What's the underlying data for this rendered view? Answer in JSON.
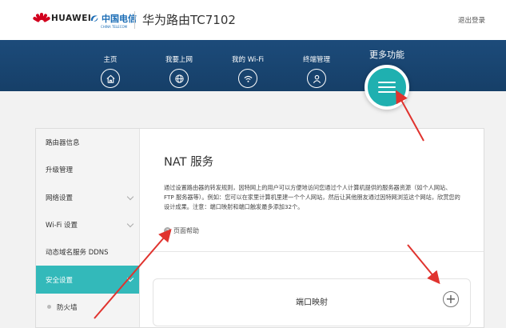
{
  "header": {
    "brand": "HUAWEI",
    "telecom_name": "中国电信",
    "telecom_sub": "CHINA TELECOM",
    "product_title": "华为路由TC7102",
    "logout_label": "退出登录"
  },
  "nav": {
    "items": [
      {
        "label": "主页",
        "icon": "home-icon"
      },
      {
        "label": "我要上网",
        "icon": "globe-icon"
      },
      {
        "label": "我的 Wi-Fi",
        "icon": "wifi-icon"
      },
      {
        "label": "终端管理",
        "icon": "user-icon"
      }
    ],
    "more_label": "更多功能",
    "more_icon": "menu-icon"
  },
  "sidebar": {
    "items": [
      {
        "label": "路由器信息"
      },
      {
        "label": "升级管理"
      },
      {
        "label": "网络设置"
      },
      {
        "label": "Wi-Fi 设置"
      },
      {
        "label": "动态域名服务 DDNS"
      },
      {
        "label": "安全设置"
      },
      {
        "label": "防火墙"
      }
    ],
    "active_index": 5
  },
  "main": {
    "title": "NAT 服务",
    "description": "通过设置路由器的转发规则，因特网上的用户可以方便地访问您通过个人计算机提供的服务器资源（如个人网站、FTP 服务器等）。例如：您可以在家里计算机里建一个个人网站，然后让其他朋友通过因特网浏览这个网站，欣赏您的设计成果。注意：端口映射和端口触发最多添加32个。",
    "help_label": "页面帮助",
    "port_mapping_title": "端口映射"
  },
  "colors": {
    "nav_bg": "#1c4b7a",
    "accent": "#33b9ba",
    "annotation_arrow": "#e0332e"
  }
}
